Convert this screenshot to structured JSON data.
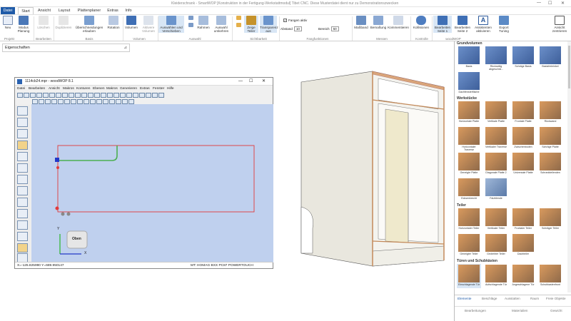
{
  "window": {
    "title": "Kleiderschrank - SmartWOP [Konstruktion in der Fertigung-Werkstattmodul] Tibet CNC. Diese Musterdatei dient nur zu Demonstrationszwecken",
    "min": "—",
    "max": "☐",
    "close": "✕"
  },
  "tabs": [
    "Datei",
    "Start",
    "Ansicht",
    "Layout",
    "Plattenplaner",
    "Extras",
    "Info"
  ],
  "ribbon": {
    "buttons": [
      {
        "label": "Neu",
        "name": "neu-button"
      },
      {
        "label": "Modus Planung",
        "name": "modus-planung-button"
      },
      {
        "label": "Löschen",
        "name": "loeschen-button"
      },
      {
        "label": "Duplizieren",
        "name": "duplizieren-button"
      },
      {
        "label": "Überschneidungen erlauben",
        "name": "ueberschneidungen-button"
      },
      {
        "label": "Rotation",
        "name": "rotation-button"
      },
      {
        "label": "Volumen",
        "name": "volumen-button"
      },
      {
        "label": "Aktivere Volumen",
        "name": "aktivere-volumen-button"
      },
      {
        "label": "Auswählen und Verschieben",
        "name": "auswaehlen-verschieben-button"
      },
      {
        "label": "Rahmen",
        "name": "rahmen-button"
      },
      {
        "label": "Auswahl umkehren",
        "name": "auswahl-umkehren-button"
      },
      {
        "label": "Zeige Teiler",
        "name": "zeige-teiler-button"
      },
      {
        "label": "Transparenz aus",
        "name": "transparenz-button"
      },
      {
        "label": "Maßband",
        "name": "massband-button"
      },
      {
        "label": "Bemaßung",
        "name": "bemassung-button"
      },
      {
        "label": "Kommentieren",
        "name": "kommentieren-button"
      },
      {
        "label": "Kollisionen",
        "name": "kollisionen-button"
      },
      {
        "label": "Bearbeiten Seite 1",
        "name": "bearbeiten-seite1-button"
      },
      {
        "label": "Bearbeiten Seite 2",
        "name": "bearbeiten-seite2-button"
      },
      {
        "label": "Assistenten aktivieren",
        "name": "assistenten-button"
      },
      {
        "label": "Export Tuning",
        "name": "export-tuning-button"
      },
      {
        "label": "Ansicht zentrieren",
        "name": "ansicht-zentrieren-button"
      }
    ],
    "groups": [
      "Projekt",
      "Bearbeiten",
      "Basis",
      "Volumen",
      "Auswahl",
      "Sichtbarkeit",
      "Fangfunktionen",
      "Messen",
      "Kontrolle",
      "woodWOP"
    ],
    "fangen": {
      "label": "Fangen aktiv",
      "checked": "✓"
    },
    "abstand": {
      "label": "Abstand",
      "value": "10"
    },
    "bereich": {
      "label": "Bereich",
      "value": "50"
    }
  },
  "props": {
    "title": "Eigenschaften",
    "pin": "⊿"
  },
  "wop": {
    "title": "1114cb24.mpr - woodWOP 8.1",
    "menu": [
      "Datei",
      "Bearbeiten",
      "Ansicht",
      "Makros",
      "Konturen",
      "Ebenen",
      "Makros",
      "Generieren",
      "Extras",
      "Fenster",
      "Hilfe"
    ],
    "status_coords": "X=-125.825990 Y=689.950147",
    "status_machine": "MT: HOMAG BXX PC87 POWERTOUCH",
    "view_label": "Oben",
    "axis_x": "X",
    "axis_y": "Y"
  },
  "library": {
    "sections": [
      "Grundvolumen",
      "Werkstücke",
      "Teiler",
      "Türen und Schubkästen"
    ],
    "grund": [
      "Basis",
      "Rückseitig abgeschrä...",
      "Schräge Basis",
      "Basisfreieinkel",
      "Dachfensterfläche"
    ],
    "werk": [
      "Horizontale Platte",
      "Vertikale Platte",
      "Frontale Platte",
      "Rückwand",
      "Horizontaler Traverse",
      "Vertikaler Traverse",
      "Zwischenboden",
      "Schräge Platte",
      "Geneigte Platte",
      "Diagonale Platte 2",
      "Universale Platte",
      "Schrankteilenden",
      "Ecksenkrecht",
      "Falzblende"
    ],
    "teiler": [
      "Horizontaler Teiler",
      "Vertikaler Teiler",
      "Frontaler Teiler",
      "Schräger Teiler",
      "Geneigter Teiler",
      "Gedrehter Teiler",
      "Dachteiler"
    ],
    "tueren": [
      "Einschlagende Tür",
      "Aufschlagende Tür",
      "Angeschlagene Tür",
      "Schubkastenfront"
    ],
    "bottom_tabs": [
      "Elemente",
      "Beschläge",
      "Ausstatten",
      "Raum",
      "Freie Objekte"
    ],
    "bottom_bar": [
      "Bearbeitungen",
      "Materialien",
      "Gewicht"
    ]
  },
  "colors": {
    "accent": "#1e5aa8",
    "canvas": "#bfd0ee",
    "outline": "#e23a3a",
    "green": "#4caf50"
  }
}
